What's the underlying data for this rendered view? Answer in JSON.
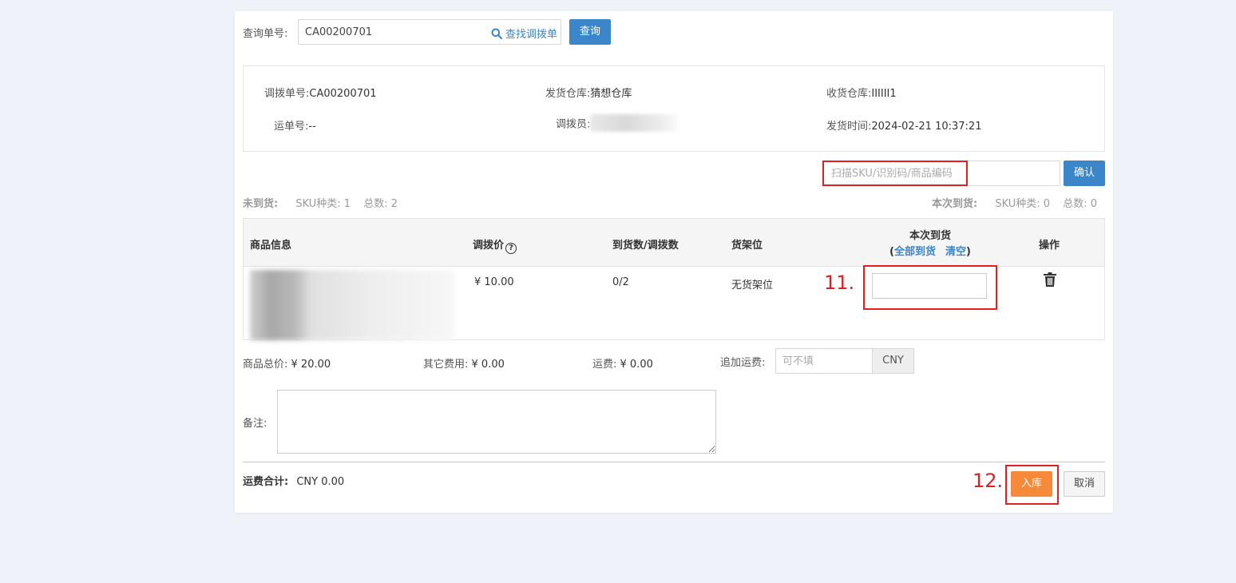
{
  "query": {
    "label": "查询单号:",
    "value": "CA00200701",
    "find_link": "查找调拨单",
    "query_button": "查询"
  },
  "info": {
    "transfer_no_label": "调拨单号:",
    "transfer_no": "CA00200701",
    "ship_wh_label": "发货仓库:",
    "ship_wh": "猜想仓库",
    "recv_wh_label": "收货仓库:",
    "recv_wh": "IIIIII1",
    "waybill_label": "运单号:",
    "waybill": "--",
    "operator_label": "调拨员:",
    "ship_time_label": "发货时间:",
    "ship_time": "2024-02-21 10:37:21"
  },
  "scan": {
    "placeholder": "扫描SKU/识别码/商品编码",
    "confirm_button": "确认"
  },
  "stats": {
    "pending_label": "未到货:",
    "pending_sku": "SKU种类: 1",
    "pending_total": "总数: 2",
    "current_label": "本次到货:",
    "current_sku": "SKU种类: 0",
    "current_total": "总数: 0"
  },
  "table": {
    "headers": {
      "product": "商品信息",
      "price": "调拨价",
      "qty": "到货数/调拨数",
      "shelf": "货架位",
      "arrival": "本次到货",
      "all_arrived": "全部到货",
      "clear": "清空",
      "action": "操作"
    },
    "rows": [
      {
        "price": "¥ 10.00",
        "qty": "0/2",
        "shelf": "无货架位",
        "arrival": ""
      }
    ]
  },
  "fees": {
    "goods_total_label": "商品总价:",
    "goods_total": "¥ 20.00",
    "other_label": "其它费用:",
    "other": "¥ 0.00",
    "freight_label": "运费:",
    "freight": "¥ 0.00",
    "extra_label": "追加运费:",
    "extra_placeholder": "可不填",
    "currency": "CNY"
  },
  "remark": {
    "label": "备注:"
  },
  "summary": {
    "freight_total_label": "运费合计:",
    "freight_total": "CNY 0.00"
  },
  "steps": {
    "s11": "11.",
    "s12": "12."
  },
  "actions": {
    "stock_in": "入库",
    "cancel": "取消"
  },
  "colors": {
    "accent": "#3a86c8",
    "orange": "#f58a3b",
    "highlight": "#e02020"
  }
}
